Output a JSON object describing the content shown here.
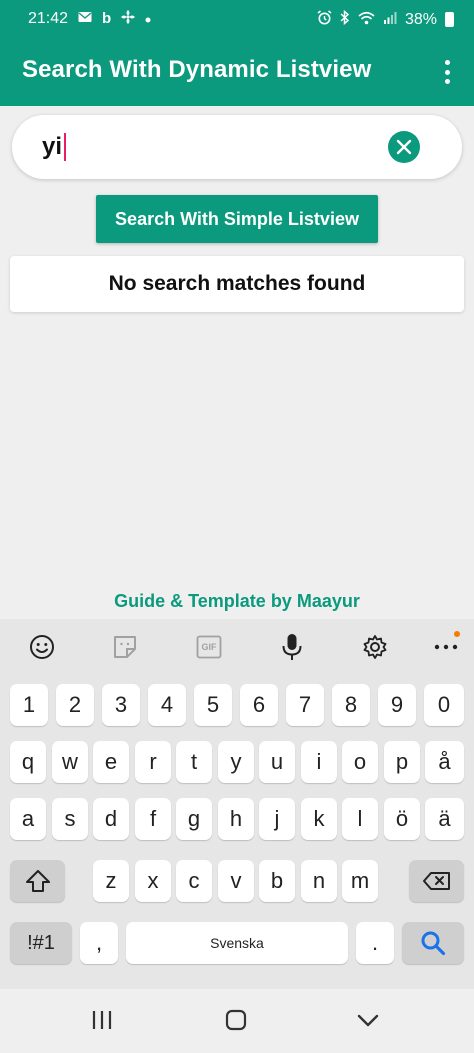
{
  "status_bar": {
    "time": "21:42",
    "left_icons": [
      "mail-icon",
      "b-icon",
      "fan-icon",
      "dot-icon"
    ],
    "right_icons": [
      "alarm-icon",
      "bluetooth-icon",
      "wifi-icon",
      "signal-icon"
    ],
    "battery": "38%"
  },
  "app_bar": {
    "title": "Search With Dynamic Listview",
    "menu_icon": "overflow-menu-icon"
  },
  "search": {
    "value": "yi",
    "clear_icon": "clear-icon"
  },
  "simple_listview_button": "Search With Simple Listview",
  "empty_message": "No search matches found",
  "credit": "Guide & Template by Maayur",
  "keyboard": {
    "toolbar_icons": [
      "emoji-icon",
      "sticker-icon",
      "gif-icon",
      "mic-icon",
      "settings-icon",
      "more-icon"
    ],
    "gif_label": "GIF",
    "rows": [
      [
        "1",
        "2",
        "3",
        "4",
        "5",
        "6",
        "7",
        "8",
        "9",
        "0"
      ],
      [
        "q",
        "w",
        "e",
        "r",
        "t",
        "y",
        "u",
        "i",
        "o",
        "p",
        "å"
      ],
      [
        "a",
        "s",
        "d",
        "f",
        "g",
        "h",
        "j",
        "k",
        "l",
        "ö",
        "ä"
      ],
      [
        "z",
        "x",
        "c",
        "v",
        "b",
        "n",
        "m"
      ]
    ],
    "symbols_label": "!#1",
    "comma": ",",
    "space_label": "Svenska",
    "period": ".",
    "shift_icon": "shift-icon",
    "backspace_icon": "backspace-icon",
    "search_icon": "search-icon"
  },
  "nav_bar": [
    "recents-icon",
    "home-icon",
    "back-icon"
  ],
  "colors": {
    "primary": "#0b9a7d",
    "background": "#efefef",
    "keyboard_bg": "#e6e6e6",
    "cursor": "#e91e63",
    "search_key_icon": "#1a73e8"
  }
}
